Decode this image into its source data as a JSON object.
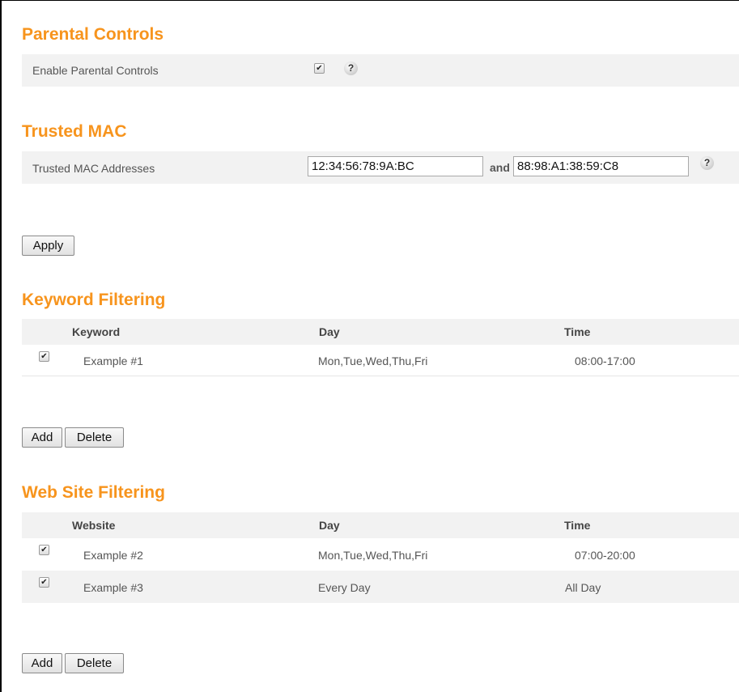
{
  "parental": {
    "title": "Parental Controls",
    "enable_label": "Enable Parental Controls",
    "enabled": true
  },
  "trusted_mac": {
    "title": "Trusted MAC",
    "label": "Trusted MAC Addresses",
    "mac1": "12:34:56:78:9A:BC",
    "joiner": "and",
    "mac2": "88:98:A1:38:59:C8"
  },
  "apply_label": "Apply",
  "keyword_filtering": {
    "title": "Keyword Filtering",
    "columns": [
      "Keyword",
      "Day",
      "Time"
    ],
    "rows": [
      {
        "checked": true,
        "name": "Example #1",
        "day": "Mon,Tue,Wed,Thu,Fri",
        "time": "08:00-17:00"
      }
    ],
    "add_label": "Add",
    "delete_label": "Delete"
  },
  "website_filtering": {
    "title": "Web Site Filtering",
    "columns": [
      "Website",
      "Day",
      "Time"
    ],
    "rows": [
      {
        "checked": true,
        "name": "Example #2",
        "day": "Mon,Tue,Wed,Thu,Fri",
        "time": "07:00-20:00"
      },
      {
        "checked": true,
        "name": "Example #3",
        "day": "Every Day",
        "time": "All Day"
      }
    ],
    "add_label": "Add",
    "delete_label": "Delete"
  },
  "icons": {
    "check": "checkmark-icon",
    "help": "question-mark-icon"
  },
  "colors": {
    "heading": "#f7941d",
    "row_band": "#f2f2f2"
  }
}
